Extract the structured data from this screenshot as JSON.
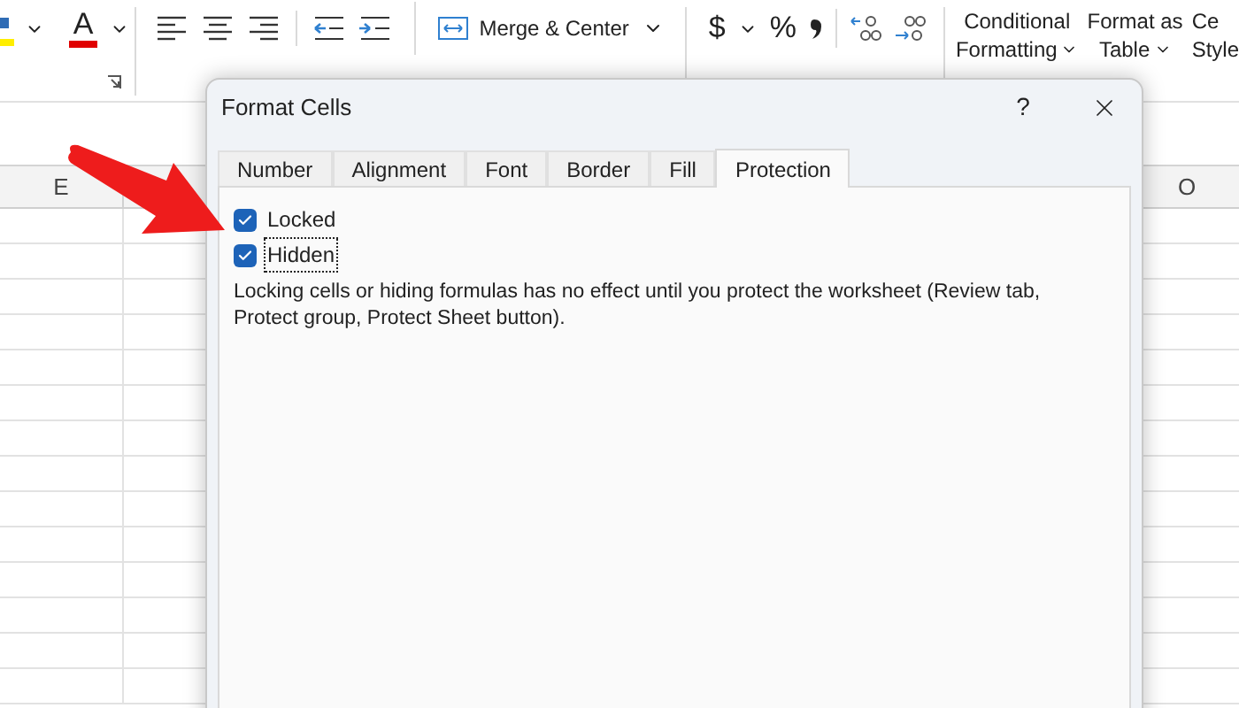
{
  "ribbon": {
    "font_color_letter": "A",
    "merge_button": "Merge & Center",
    "currency_symbol": "$",
    "percent_symbol": "%",
    "conditional_formatting": [
      "Conditional",
      "Formatting"
    ],
    "format_as_table": [
      "Format as",
      "Table"
    ],
    "cell_styles": [
      "Ce",
      "Style"
    ]
  },
  "sheet": {
    "column_headers": [
      "E",
      "O"
    ]
  },
  "dialog": {
    "title": "Format Cells",
    "help": "?",
    "tabs": [
      {
        "label": "Number",
        "selected": false
      },
      {
        "label": "Alignment",
        "selected": false
      },
      {
        "label": "Font",
        "selected": false
      },
      {
        "label": "Border",
        "selected": false
      },
      {
        "label": "Fill",
        "selected": false
      },
      {
        "label": "Protection",
        "selected": true
      }
    ],
    "checkboxes": [
      {
        "label": "Locked",
        "checked": true,
        "focused": false
      },
      {
        "label": "Hidden",
        "checked": true,
        "focused": true
      }
    ],
    "note": "Locking cells or hiding formulas has no effect until you protect the worksheet (Review tab, Protect group, Protect Sheet button)."
  }
}
